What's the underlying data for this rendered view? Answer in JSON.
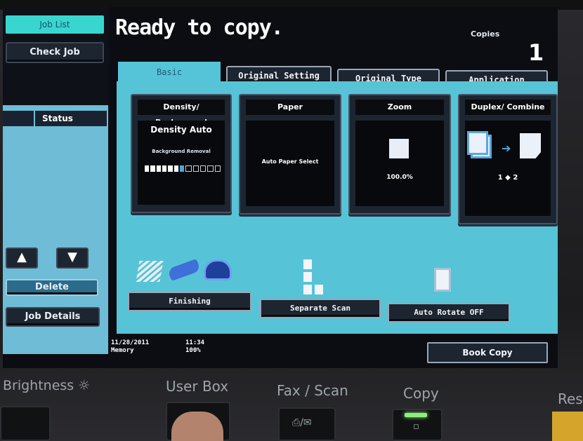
{
  "left_panel": {
    "job_list_label": "Job List",
    "check_job_label": "Check Job",
    "status_col1": "",
    "status_col2": "Status",
    "up_arrow": "▲",
    "down_arrow": "▼",
    "delete_label": "Delete",
    "job_details_label": "Job Details"
  },
  "header": {
    "title": "Ready to copy.",
    "copies_label": "Copies",
    "copies_value": "1"
  },
  "tabs": [
    {
      "label": "Basic",
      "active": true
    },
    {
      "label": "Original Setting",
      "active": false
    },
    {
      "label": "Original Type",
      "active": false
    },
    {
      "label": "Application",
      "active": false
    }
  ],
  "cards": {
    "density": {
      "head": "Density/ Background",
      "main": "Density Auto",
      "sub": "Background Removal",
      "level": 7,
      "levels": 12
    },
    "paper": {
      "head": "Paper",
      "value": "Auto Paper Select"
    },
    "zoom": {
      "head": "Zoom",
      "value": "100.0%"
    },
    "duplex": {
      "head": "Duplex/ Combine",
      "value": "1 ◆ 2"
    }
  },
  "functions": {
    "finishing_label": "Finishing",
    "separate_scan_label": "Separate Scan",
    "auto_rotate_label": "Auto Rotate OFF"
  },
  "status_bar": {
    "date": "11/28/2011",
    "time": "11:34",
    "memory_label": "Memory",
    "memory_value": "100%",
    "book_copy_label": "Book Copy"
  },
  "hardware": {
    "brightness_label": "Brightness ☼",
    "user_box_label": "User Box",
    "fax_scan_label": "Fax / Scan",
    "copy_label": "Copy",
    "reset_label": "Res"
  },
  "colors": {
    "accent_cyan": "#56c4d6",
    "active_tab": "#39d6d0",
    "button_dark": "#1d2530",
    "led_green": "#8df07a"
  }
}
